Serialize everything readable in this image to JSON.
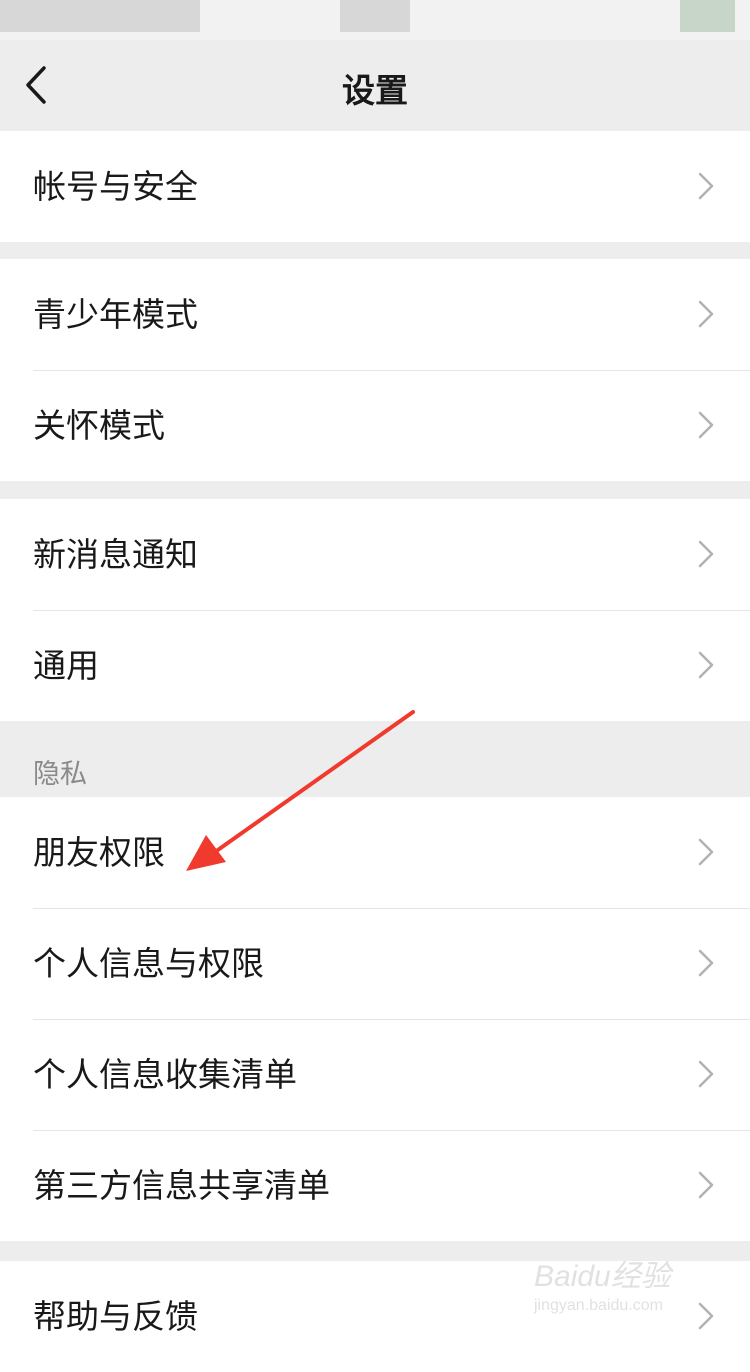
{
  "navbar": {
    "title": "设置"
  },
  "groups": [
    {
      "items": [
        {
          "label": "帐号与安全"
        }
      ]
    },
    {
      "items": [
        {
          "label": "青少年模式"
        },
        {
          "label": "关怀模式"
        }
      ]
    },
    {
      "items": [
        {
          "label": "新消息通知"
        },
        {
          "label": "通用"
        }
      ]
    },
    {
      "section_title": "隐私",
      "items": [
        {
          "label": "朋友权限"
        },
        {
          "label": "个人信息与权限"
        },
        {
          "label": "个人信息收集清单"
        },
        {
          "label": "第三方信息共享清单"
        }
      ]
    },
    {
      "items": [
        {
          "label": "帮助与反馈"
        }
      ]
    }
  ],
  "watermark": {
    "brand": "Baidu经验",
    "url": "jingyan.baidu.com"
  },
  "colors": {
    "background": "#ededed",
    "row_background": "#ffffff",
    "annotation_arrow": "#f03a2e",
    "chevron": "#b2b2b2"
  }
}
